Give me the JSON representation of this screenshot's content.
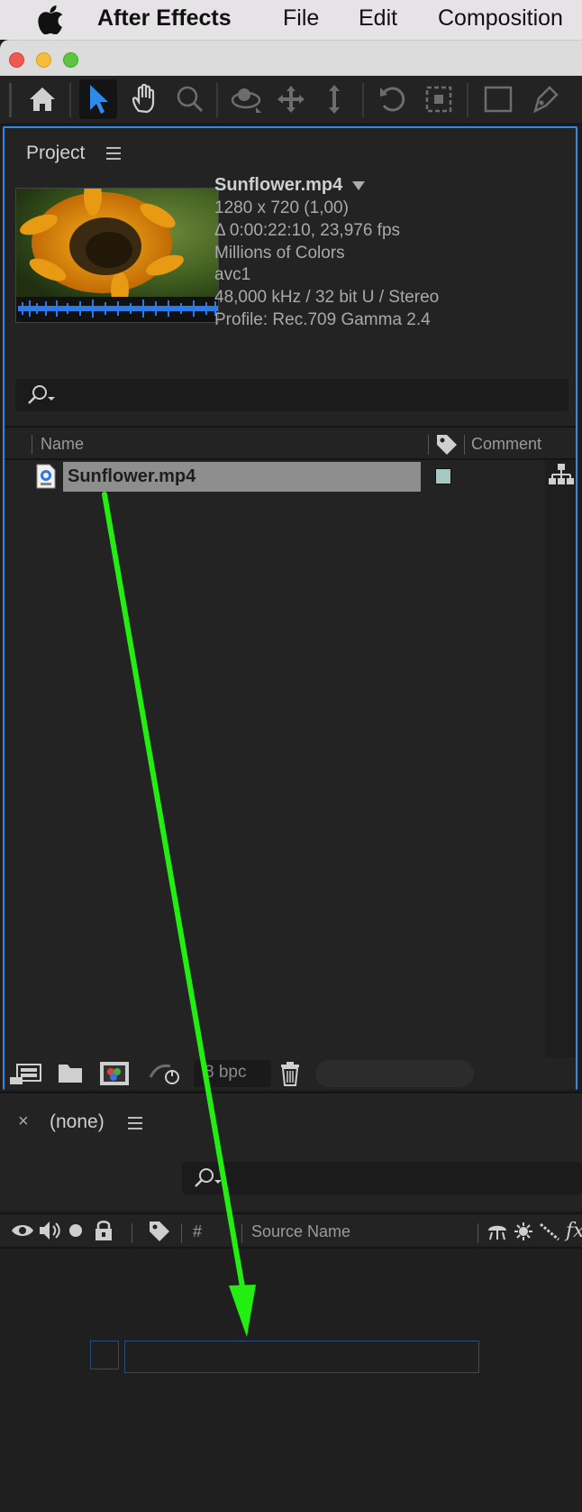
{
  "menubar": {
    "app_name": "After Effects",
    "items": [
      "File",
      "Edit",
      "Composition"
    ]
  },
  "toolbar": {
    "tools": [
      "home-icon",
      "selection-tool-icon",
      "hand-tool-icon",
      "zoom-tool-icon",
      "orbit-camera-icon",
      "pan-camera-icon",
      "dolly-camera-icon",
      "rotate-tool-icon",
      "anchor-point-icon",
      "rectangle-tool-icon",
      "pen-tool-icon"
    ],
    "active_tool": "selection-tool-icon"
  },
  "project": {
    "title": "Project",
    "preview": {
      "name": "Sunflower.mp4",
      "resolution": "1280 x 720 (1,00)",
      "duration": "Δ 0:00:22:10, 23,976 fps",
      "colors": "Millions of Colors",
      "codec": "avc1",
      "audio": "48,000 kHz / 32 bit U / Stereo",
      "profile": "Profile: Rec.709 Gamma 2.4"
    },
    "columns": {
      "name": "Name",
      "comment": "Comment"
    },
    "items": [
      {
        "name": "Sunflower.mp4",
        "label_color": "#a6c7c2",
        "selected": true
      }
    ],
    "footer": {
      "bpc": "8 bpc"
    }
  },
  "timeline": {
    "close": "×",
    "title": "(none)",
    "columns": {
      "number": "#",
      "source_name": "Source Name"
    }
  },
  "colors": {
    "accent_blue": "#2d8ceb",
    "annotation_arrow": "#22ee11"
  }
}
